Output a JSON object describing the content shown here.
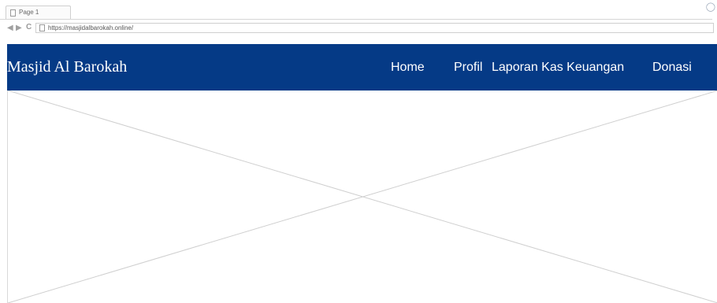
{
  "browser": {
    "tab_title": "Page 1",
    "url": "https://masjidalbarokah.online/",
    "icons": {
      "back": "back-arrow-icon",
      "forward": "forward-arrow-icon",
      "reload": "reload-icon",
      "page": "page-icon",
      "search": "search-icon"
    }
  },
  "site": {
    "title": "Masjid Al Barokah",
    "nav": {
      "home": "Home",
      "profil": "Profil",
      "laporan": "Laporan Kas Keuangan",
      "donasi": "Donasi"
    },
    "colors": {
      "header_bg": "#053a86",
      "header_text": "#ffffff"
    }
  },
  "hero": {
    "type": "image-placeholder"
  }
}
